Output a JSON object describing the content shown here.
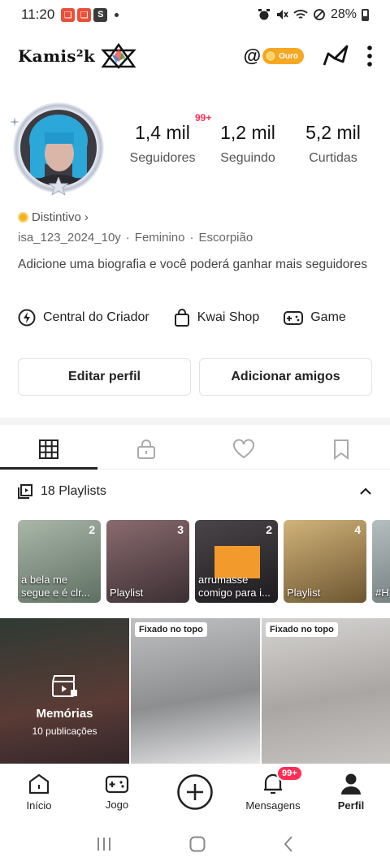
{
  "status_bar": {
    "time": "11:20",
    "app_badge_1": "❏",
    "app_badge_2": "❏",
    "app_badge_3": "S",
    "battery": "28%"
  },
  "header": {
    "brand": "Kamis²k",
    "badge_label": "Ouro"
  },
  "profile": {
    "notification_badge": "99+",
    "stats": [
      {
        "value": "1,4 mil",
        "label": "Seguidores"
      },
      {
        "value": "1,2 mil",
        "label": "Seguindo"
      },
      {
        "value": "5,2 mil",
        "label": "Curtidas"
      }
    ],
    "distintivo": "Distintivo",
    "username": "isa_123_2024_10y",
    "gender": "Feminino",
    "sign": "Escorpião",
    "separator": "·",
    "bio": "Adicione uma biografia e você poderá ganhar mais seguidores"
  },
  "tools": [
    {
      "label": "Central do Criador",
      "icon": "lightning-icon"
    },
    {
      "label": "Kwai Shop",
      "icon": "bag-icon"
    },
    {
      "label": "Game",
      "icon": "gamepad-icon"
    }
  ],
  "buttons": {
    "edit": "Editar perfil",
    "add_friends": "Adicionar amigos"
  },
  "playlists": {
    "header": "18 Playlists",
    "items": [
      {
        "count": "2",
        "caption": "a bela me segue e é clr...",
        "color": "#7a8b7d"
      },
      {
        "count": "3",
        "caption": "Playlist",
        "color": "#5b4a4e"
      },
      {
        "count": "2",
        "caption": "arrumasse comigo para i...",
        "color": "#2d2b30"
      },
      {
        "count": "4",
        "caption": "Playlist",
        "color": "#a98d5e"
      },
      {
        "count": "",
        "caption": "#H",
        "color": "#8d9596"
      }
    ]
  },
  "grid": {
    "memories_title": "Memórias",
    "memories_sub": "10 publicações",
    "pinned_label_1": "Fixado no topo",
    "pinned_label_2": "Fixado no topo"
  },
  "bottom_nav": [
    {
      "label": "Início",
      "icon": "home-icon"
    },
    {
      "label": "Jogo",
      "icon": "gamepad-icon"
    },
    {
      "label": "",
      "icon": "plus-circle-icon"
    },
    {
      "label": "Mensagens",
      "icon": "bell-icon",
      "badge": "99+"
    },
    {
      "label": "Perfil",
      "icon": "person-icon"
    }
  ],
  "colors": {
    "accent": "#ff2d55",
    "gold": "#f7a823"
  }
}
